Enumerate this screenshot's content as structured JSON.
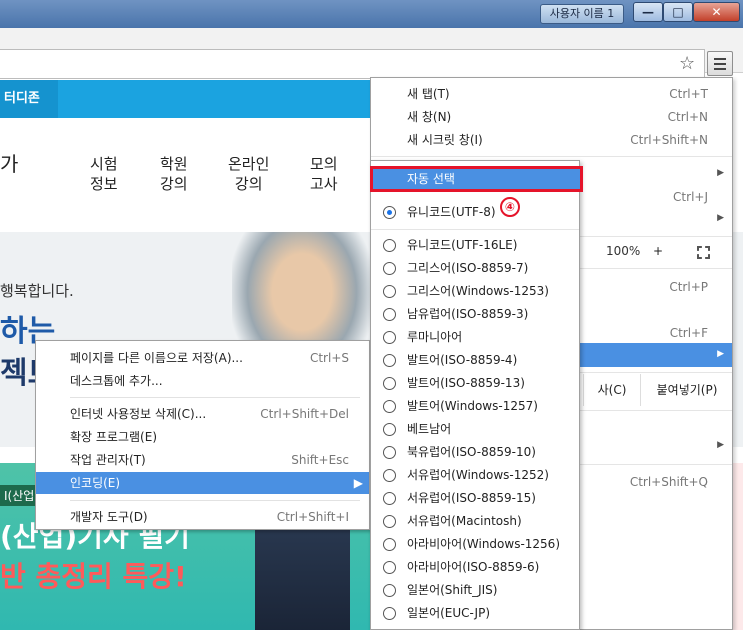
{
  "window": {
    "user_button": "사용자 이름 1",
    "min_glyph": "—",
    "max_glyph": "□",
    "close_glyph": "✕"
  },
  "page": {
    "top_tab": "터디존",
    "nav": [
      {
        "line1": "시험",
        "line2": "정보"
      },
      {
        "line1": "학원",
        "line2": "강의"
      },
      {
        "line1": "온라인",
        "line2": "강의"
      },
      {
        "line1": "모의",
        "line2": "고사"
      }
    ],
    "hero_line1": "행복합니다.",
    "hero_line2": "하는",
    "hero_line3": "젝트",
    "banner_tag": "I(산업)",
    "banner_line1": "(산업)기사 필기",
    "banner_line2": "반 총정리 특강!"
  },
  "context_menu": {
    "items": [
      {
        "label": "페이지를 다른 이름으로 저장(A)...",
        "shortcut": "Ctrl+S"
      },
      {
        "label": "데스크톱에 추가...",
        "shortcut": ""
      },
      {
        "label": "인터넷 사용정보 삭제(C)...",
        "shortcut": "Ctrl+Shift+Del"
      },
      {
        "label": "확장 프로그램(E)",
        "shortcut": ""
      },
      {
        "label": "작업 관리자(T)",
        "shortcut": "Shift+Esc"
      },
      {
        "label": "인코딩(E)",
        "shortcut": ""
      },
      {
        "label": "개발자 도구(D)",
        "shortcut": "Ctrl+Shift+I"
      }
    ]
  },
  "chrome_menu": {
    "items": [
      {
        "label": "새 탭(T)",
        "shortcut": "Ctrl+T"
      },
      {
        "label": "새 창(N)",
        "shortcut": "Ctrl+N"
      },
      {
        "label": "새 시크릿 창(I)",
        "shortcut": "Ctrl+Shift+N"
      }
    ],
    "shortcut_j": "Ctrl+J",
    "zoom_value": "100%",
    "zoom_plus": "+",
    "shortcut_p": "Ctrl+P",
    "shortcut_f": "Ctrl+F",
    "copy_label": "사(C)",
    "paste_label": "붙여넣기(P)",
    "shortcut_q": "Ctrl+Shift+Q"
  },
  "encoding_menu": {
    "auto_select": "자동 선택",
    "step_marker": "④",
    "selected": "유니코드(UTF-8)",
    "items": [
      "유니코드(UTF-16LE)",
      "그리스어(ISO-8859-7)",
      "그리스어(Windows-1253)",
      "남유럽어(ISO-8859-3)",
      "루마니아어",
      "발트어(ISO-8859-4)",
      "발트어(ISO-8859-13)",
      "발트어(Windows-1257)",
      "베트남어",
      "북유럽어(ISO-8859-10)",
      "서유럽어(Windows-1252)",
      "서유럽어(ISO-8859-15)",
      "서유럽어(Macintosh)",
      "아라비아어(Windows-1256)",
      "아라비아어(ISO-8859-6)",
      "일본어(Shift_JIS)",
      "일본어(EUC-JP)"
    ]
  },
  "colors": {
    "highlight": "#4a90e2",
    "annotation_red": "#e5142a",
    "site_blue": "#1ba3e0"
  }
}
